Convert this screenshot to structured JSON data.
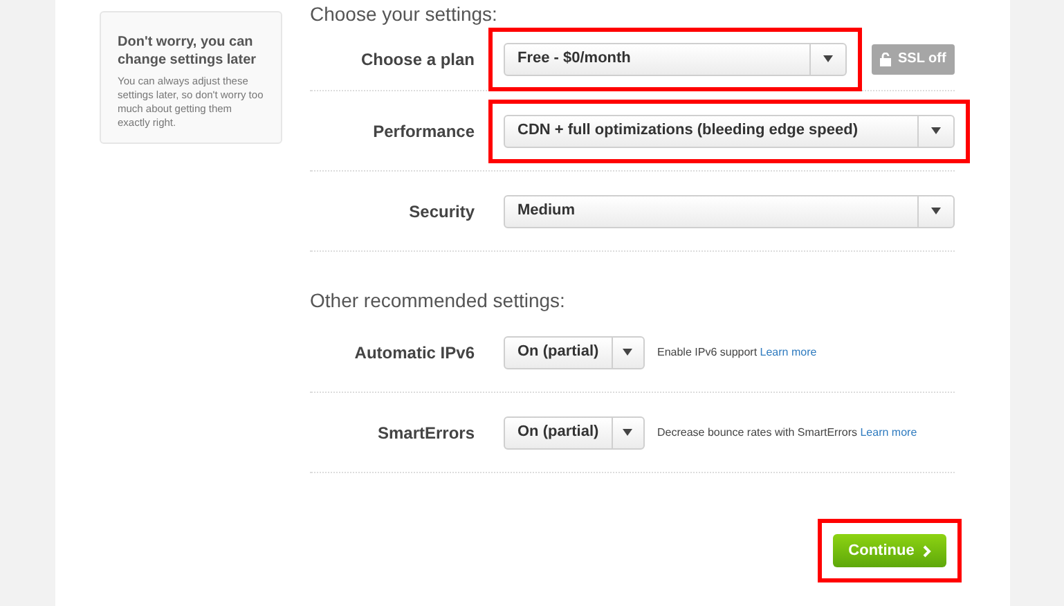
{
  "tip": {
    "title": "Don't worry, you can change settings later",
    "body": "You can always adjust these settings later, so don't worry too much about getting them exactly right."
  },
  "sections": [
    {
      "heading": "Choose your settings:",
      "rows": [
        {
          "kind": "wide",
          "label": "Choose a plan",
          "value": "Free - $0/month",
          "highlighted": true,
          "badge": "SSL off"
        },
        {
          "kind": "wide",
          "label": "Performance",
          "value": "CDN + full optimizations (bleeding edge speed)",
          "highlighted": true
        },
        {
          "kind": "wide",
          "label": "Security",
          "value": "Medium",
          "highlighted": false
        }
      ]
    },
    {
      "heading": "Other recommended settings:",
      "rows": [
        {
          "kind": "small",
          "label": "Automatic IPv6",
          "value": "On (partial)",
          "highlighted": false,
          "note": "Enable IPv6 support",
          "link": "Learn more"
        },
        {
          "kind": "small",
          "label": "SmartErrors",
          "value": "On (partial)",
          "highlighted": false,
          "note": "Decrease bounce rates with SmartErrors",
          "link": "Learn more"
        }
      ]
    }
  ],
  "continue": {
    "label": "Continue",
    "highlighted": true
  }
}
